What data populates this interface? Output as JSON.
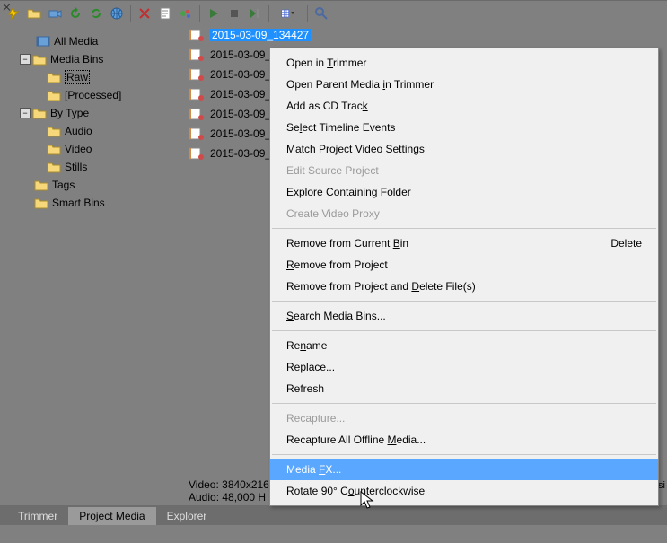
{
  "tree": {
    "all_media": "All Media",
    "media_bins": "Media Bins",
    "raw": "Raw",
    "processed": "[Processed]",
    "by_type": "By Type",
    "audio": "Audio",
    "video": "Video",
    "stills": "Stills",
    "tags": "Tags",
    "smart_bins": "Smart Bins"
  },
  "media": {
    "items": [
      "2015-03-09_134427",
      "2015-03-09_",
      "2015-03-09_",
      "2015-03-09_",
      "2015-03-09_",
      "2015-03-09_",
      "2015-03-09_"
    ]
  },
  "status": {
    "video": "Video: 3840x216",
    "audio": "Audio: 48,000 H",
    "right": "progressi"
  },
  "tabs": {
    "trimmer": "Trimmer",
    "project_media": "Project Media",
    "explorer": "Explorer"
  },
  "menu": {
    "open_trimmer_pre": "Open in ",
    "open_trimmer_u": "T",
    "open_trimmer_post": "rimmer",
    "open_parent_pre": "Open Parent Media ",
    "open_parent_u": "i",
    "open_parent_post": "n Trimmer",
    "add_cd_pre": "Add as CD Trac",
    "add_cd_u": "k",
    "select_timeline_pre": "Se",
    "select_timeline_u": "l",
    "select_timeline_post": "ect Timeline Events",
    "match_settings": "Match Project Video Settings",
    "edit_source_pre": "Edit Source Pro",
    "edit_source_u": "j",
    "edit_source_post": "ect",
    "explore_pre": "Explore ",
    "explore_u": "C",
    "explore_post": "ontaining Folder",
    "create_proxy": "Create Video Proxy",
    "remove_bin_pre": "Remove from Current ",
    "remove_bin_u": "B",
    "remove_bin_post": "in",
    "remove_bin_shortcut": "Delete",
    "remove_project_pre": "",
    "remove_project_u": "R",
    "remove_project_post": "emove from Project",
    "remove_delete_pre": "Remove from Project and ",
    "remove_delete_u": "D",
    "remove_delete_post": "elete File(s)",
    "search_pre": "",
    "search_u": "S",
    "search_post": "earch Media Bins...",
    "rename_pre": "Re",
    "rename_u": "n",
    "rename_post": "ame",
    "replace_pre": "Re",
    "replace_u": "p",
    "replace_post": "lace...",
    "refresh": "Refresh",
    "recapture": "Recapture...",
    "recapture_all_pre": "Recapture All Offline ",
    "recapture_all_u": "M",
    "recapture_all_post": "edia...",
    "media_fx_pre": "Media ",
    "media_fx_u": "F",
    "media_fx_post": "X...",
    "rotate_pre": "Rotate 90° C",
    "rotate_u": "o",
    "rotate_post": "unterclockwise"
  }
}
